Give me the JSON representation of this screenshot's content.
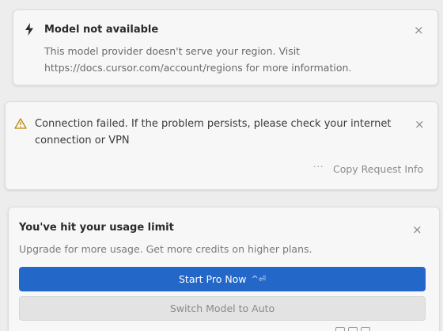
{
  "model_card": {
    "title": "Model not available",
    "body": "This model provider doesn't serve your region. Visit https://docs.cursor.com/account/regions for more information.",
    "close_label": "×"
  },
  "connection_card": {
    "message": "Connection failed. If the problem persists, please check your internet connection or VPN",
    "close_label": "×",
    "more_label": "...",
    "copy_label": "Copy Request Info"
  },
  "usage_card": {
    "title": "You've hit your usage limit",
    "subtitle": "Upgrade for more usage. Get more credits on higher plans.",
    "close_label": "×",
    "primary_label": "Start Pro Now",
    "primary_shortcut": "^⏎",
    "secondary_label": "Switch Model to Auto"
  },
  "icons": {
    "bolt": "lightning-icon",
    "warning": "warning-icon"
  },
  "colors": {
    "primary_button": "#2367c9",
    "warning_icon": "#b8860b"
  }
}
